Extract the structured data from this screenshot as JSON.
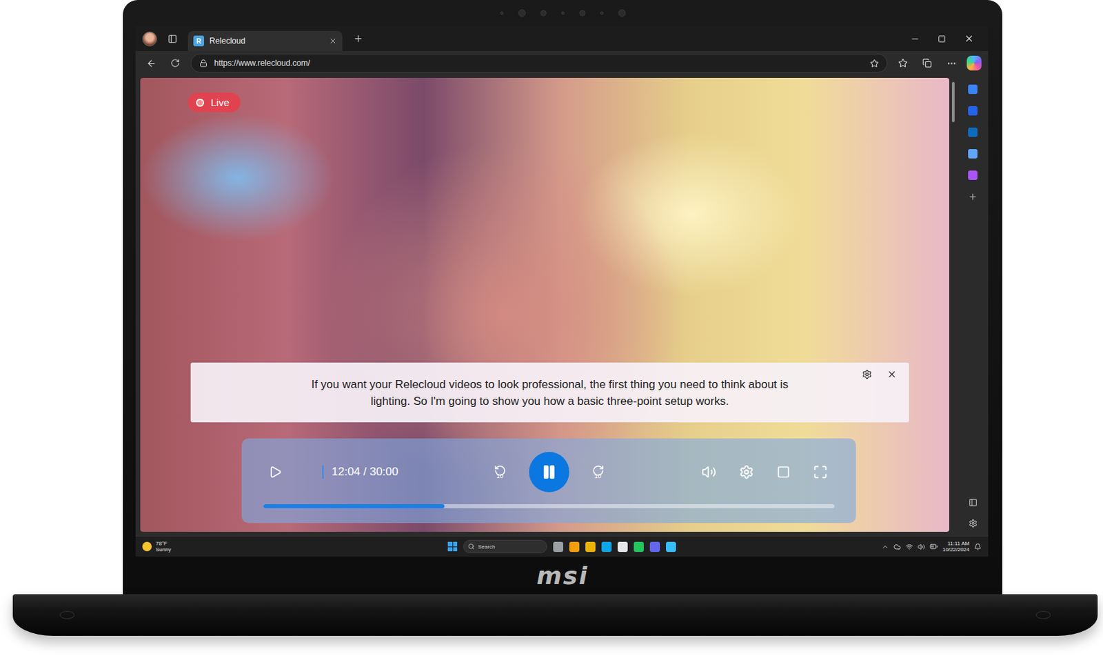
{
  "window": {
    "title": "Relecloud",
    "favicon": "R"
  },
  "address_bar": {
    "url": "https://www.relecloud.com/"
  },
  "video": {
    "live_badge": "Live",
    "playing": true,
    "caption": "If you want your Relecloud videos to look professional, the first thing you need to think about is lighting. So I'm going to show you how a basic three-point setup works.",
    "time": "12:04 / 30:00",
    "skip_back": "10",
    "skip_forward": "10",
    "level": 0.317
  },
  "laptop": {
    "brand": "msi"
  },
  "taskbar": {
    "weather": {
      "temp": "78°F",
      "condition": "Sunny"
    },
    "search_placeholder": "Search",
    "time": "11:11 AM",
    "date": "10/22/2024"
  }
}
